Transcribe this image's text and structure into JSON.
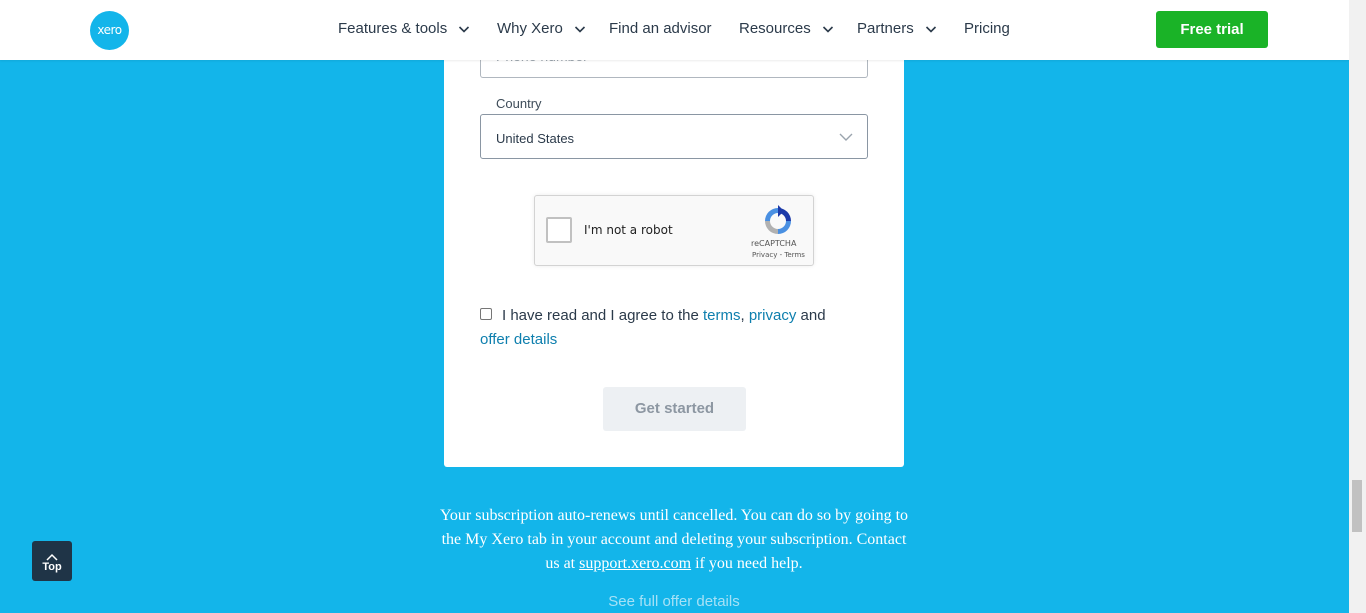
{
  "header": {
    "logo_text": "xero",
    "nav": [
      {
        "label": "Features & tools",
        "dropdown": true
      },
      {
        "label": "Why Xero",
        "dropdown": true
      },
      {
        "label": "Find an advisor",
        "dropdown": false
      },
      {
        "label": "Resources",
        "dropdown": true
      },
      {
        "label": "Partners",
        "dropdown": true
      },
      {
        "label": "Pricing",
        "dropdown": false
      }
    ],
    "cta_label": "Free trial"
  },
  "form": {
    "phone_placeholder": "Phone number",
    "country_label": "Country",
    "country_value": "United States",
    "recaptcha": {
      "label": "I'm not a robot",
      "brand": "reCAPTCHA",
      "links": "Privacy - Terms"
    },
    "agreement": {
      "prefix": "I have read and I agree to the ",
      "terms": "terms",
      "comma": ", ",
      "privacy": "privacy",
      "and": " and ",
      "offer_details": "offer details"
    },
    "submit_label": "Get started"
  },
  "footer": {
    "renew_text_1": "Your subscription auto-renews until cancelled. You can do so by going to the My Xero tab in your account and deleting your subscription. Contact us at ",
    "support_link": "support.xero.com",
    "renew_text_2": " if you need help.",
    "offer_link": "See full offer details"
  },
  "back_to_top": {
    "label": "Top"
  },
  "colors": {
    "background": "#13b5ea",
    "cta_green": "#1ab327",
    "link_blue": "#0e7fae"
  }
}
